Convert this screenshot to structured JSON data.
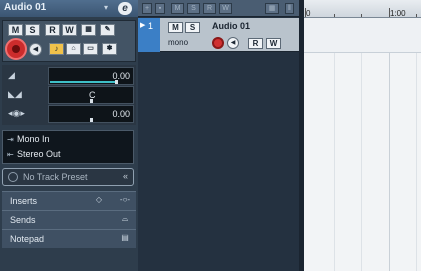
{
  "inspector": {
    "title": "Audio 01",
    "e_label": "e",
    "buttons_row1": [
      "M",
      "S",
      "R",
      "W"
    ],
    "fader_values": [
      "0.00",
      "C",
      "0.00"
    ],
    "input": "Mono In",
    "output": "Stereo Out",
    "preset_placeholder": "No Track Preset",
    "sections": [
      "Inserts",
      "Sends",
      "Notepad"
    ]
  },
  "track": {
    "number": "1",
    "name": "Audio 01",
    "channel": "mono",
    "mute": "M",
    "solo": "S",
    "read": "R",
    "write": "W"
  },
  "ruler": {
    "labels": [
      "0",
      "1:00"
    ]
  },
  "colors": {
    "accent": "#3b7fc6",
    "record": "#cc2c2c"
  }
}
